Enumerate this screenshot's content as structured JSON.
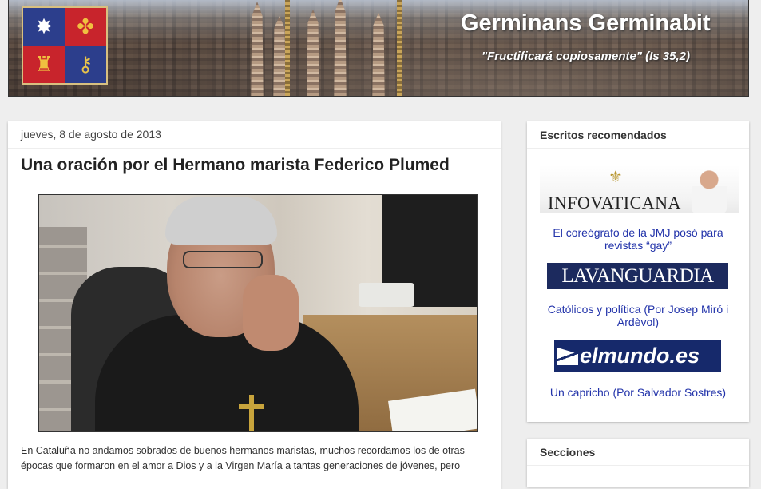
{
  "header": {
    "title": "Germinans Germinabit",
    "subtitle": "\"Fructificará copiosamente\" (Is 35,2)",
    "crest_icons": [
      "star-icon",
      "bees-icon",
      "castle-icon",
      "crossed-keys-icon"
    ]
  },
  "post": {
    "date": "jueves, 8 de agosto de 2013",
    "title": "Una oración por el Hermano marista Federico Plumed",
    "body": "En Cataluña no andamos sobrados de buenos hermanos maristas, muchos recordamos los de otras épocas que formaron en el amor a Dios y a la Virgen María a tantas generaciones de jóvenes, pero"
  },
  "sidebar": {
    "recommended": {
      "title": "Escritos recomendados",
      "items": [
        {
          "logo": "INFOVATICANA",
          "link": "El coreógrafo de la JMJ posó para revistas “gay”"
        },
        {
          "logo": "LAVANGUARDIA",
          "link": "Católicos y política (Por Josep Miró i Ardèvol)"
        },
        {
          "logo": "elmundo.es",
          "link": "Un capricho (Por Salvador Sostres)"
        }
      ]
    },
    "sections": {
      "title": "Secciones"
    }
  },
  "colors": {
    "page_background": "#eeeeee",
    "link": "#2233aa",
    "lavanguardia_bg": "#1c2a5e",
    "elmundo_bg": "#16296b"
  }
}
